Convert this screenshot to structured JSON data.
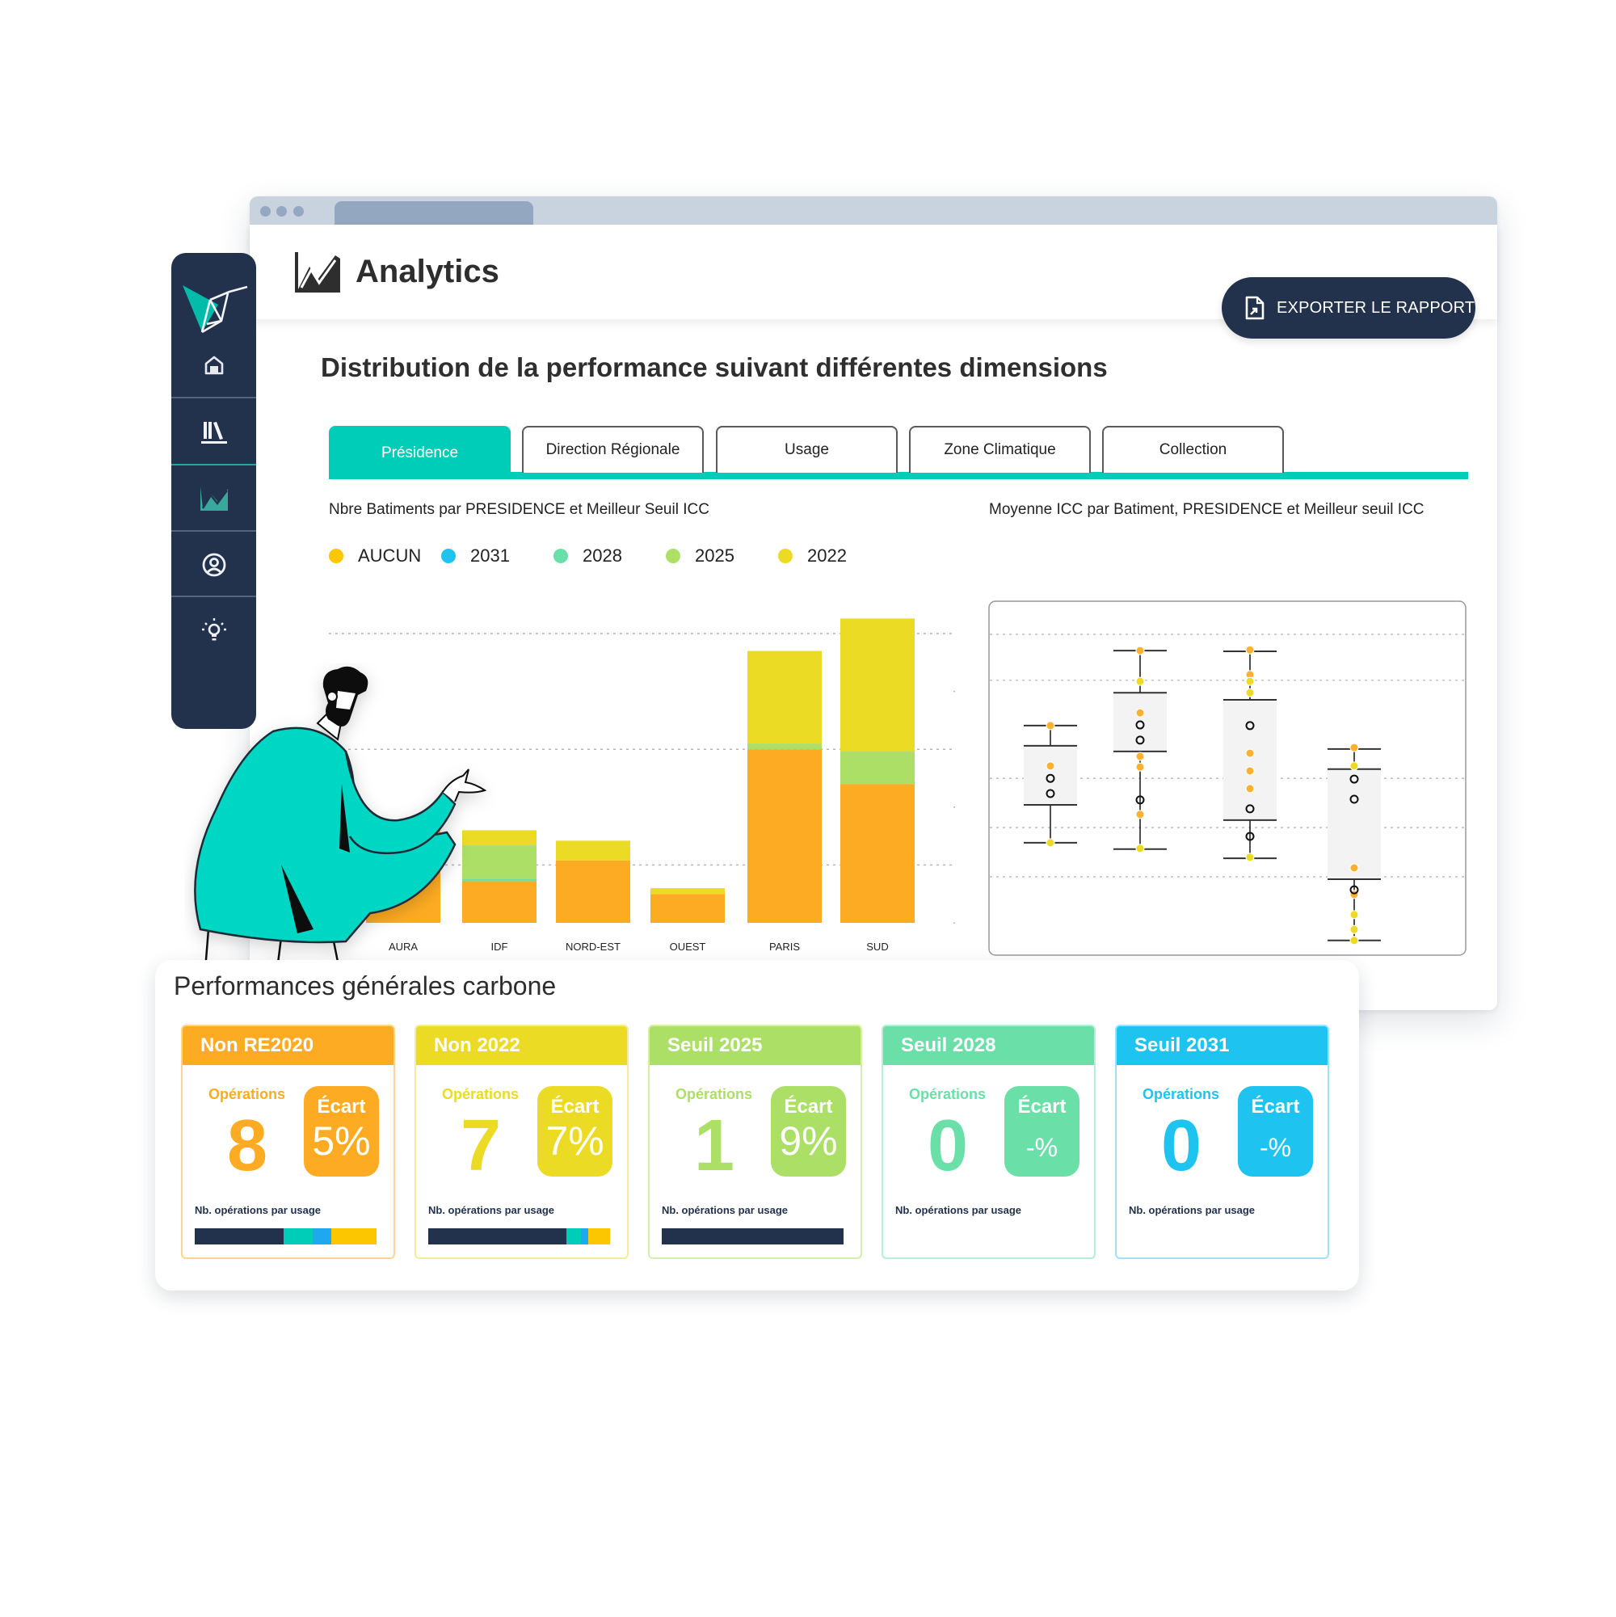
{
  "window": {
    "title": "Analytics",
    "browser_dots": 3
  },
  "header": {
    "title": "Analytics",
    "icon": "analytics-chart-icon",
    "export_label": "EXPORTER LE RAPPORT",
    "export_icon": "file-export-icon"
  },
  "sidebar": {
    "logo": "origami-bird-logo",
    "items": [
      {
        "name": "home",
        "icon": "home-icon",
        "active": false
      },
      {
        "name": "library",
        "icon": "library-icon",
        "active": false
      },
      {
        "name": "analytics",
        "icon": "analytics-chart-icon",
        "active": true
      },
      {
        "name": "profile",
        "icon": "user-circle-icon",
        "active": false
      },
      {
        "name": "ideas",
        "icon": "lightbulb-icon",
        "active": false
      }
    ]
  },
  "colors": {
    "navy": "#22324c",
    "teal": "#00cdb7",
    "aucun": "#fcc600",
    "s2031": "#1fc3ef",
    "s2028": "#6adfa8",
    "s2025": "#acdf66",
    "s2022": "#ecdb24",
    "bar_aucun": "#fdab22"
  },
  "section_title": "Distribution de la performance suivant différentes dimensions",
  "tabs": [
    {
      "label": "Présidence",
      "active": true
    },
    {
      "label": "Direction Régionale",
      "active": false
    },
    {
      "label": "Usage",
      "active": false
    },
    {
      "label": "Zone Climatique",
      "active": false
    },
    {
      "label": "Collection",
      "active": false
    }
  ],
  "chart_data": [
    {
      "type": "bar",
      "stacked": true,
      "title": "Nbre Batiments par PRESIDENCE et Meilleur Seuil ICC",
      "xlabel": "",
      "ylabel": "",
      "legend": [
        "AUCUN",
        "2031",
        "2028",
        "2025",
        "2022"
      ],
      "legend_position": "top-left",
      "grid": true,
      "ylim": [
        0,
        27
      ],
      "gridlines": [
        5,
        15,
        25
      ],
      "ticks": [
        0,
        10,
        20
      ],
      "categories": [
        "AURA",
        "IDF",
        "NORD-EST",
        "OUEST",
        "PARIS",
        "SUD"
      ],
      "series": [
        {
          "name": "AUCUN",
          "values": [
            8.0,
            3.6,
            5.4,
            2.5,
            15.0,
            12.0
          ]
        },
        {
          "name": "2031",
          "values": [
            0,
            0,
            0,
            0,
            0,
            0
          ]
        },
        {
          "name": "2028",
          "values": [
            0,
            0.2,
            0,
            0,
            0,
            0
          ]
        },
        {
          "name": "2025",
          "values": [
            0.2,
            2.9,
            0,
            0,
            0.5,
            2.8
          ]
        },
        {
          "name": "2022",
          "values": [
            0.3,
            1.3,
            1.7,
            0.5,
            8.0,
            11.5
          ]
        }
      ]
    },
    {
      "type": "box",
      "title": "Moyenne ICC par Batiment, PRESIDENCE et Meilleur seuil ICC",
      "xlabel": "",
      "ylabel": "",
      "ylim": [
        0,
        100
      ],
      "grid": true,
      "gridlines": [
        90.2,
        77.2,
        49.5,
        35.6,
        21.7
      ],
      "boxes": [
        {
          "whisker_high": 64.4,
          "q3": 58.7,
          "q1": 42.0,
          "whisker_low": 31.3,
          "points": [
            {
              "v": 64.4,
              "s": "AUCUN"
            },
            {
              "v": 53.0,
              "s": "AUCUN"
            },
            {
              "v": 49.5,
              "s": "outlier"
            },
            {
              "v": 45.2,
              "s": "outlier"
            },
            {
              "v": 31.3,
              "s": "2022"
            }
          ]
        },
        {
          "whisker_high": 85.6,
          "q3": 73.7,
          "q1": 57.1,
          "whisker_low": 29.5,
          "points": [
            {
              "v": 85.6,
              "s": "AUCUN"
            },
            {
              "v": 76.9,
              "s": "2022"
            },
            {
              "v": 68.0,
              "s": "AUCUN"
            },
            {
              "v": 64.6,
              "s": "outlier"
            },
            {
              "v": 60.3,
              "s": "outlier"
            },
            {
              "v": 55.7,
              "s": "AUCUN"
            },
            {
              "v": 52.7,
              "s": "AUCUN"
            },
            {
              "v": 43.4,
              "s": "outlier"
            },
            {
              "v": 39.3,
              "s": "AUCUN"
            },
            {
              "v": 29.7,
              "s": "2022"
            }
          ]
        },
        {
          "whisker_high": 85.4,
          "q3": 71.7,
          "q1": 37.7,
          "whisker_low": 26.9,
          "points": [
            {
              "v": 85.8,
              "s": "AUCUN"
            },
            {
              "v": 78.8,
              "s": "AUCUN"
            },
            {
              "v": 76.9,
              "s": "2022"
            },
            {
              "v": 73.7,
              "s": "2022"
            },
            {
              "v": 64.4,
              "s": "outlier"
            },
            {
              "v": 56.6,
              "s": "AUCUN"
            },
            {
              "v": 51.6,
              "s": "AUCUN"
            },
            {
              "v": 46.6,
              "s": "AUCUN"
            },
            {
              "v": 40.9,
              "s": "outlier"
            },
            {
              "v": 33.1,
              "s": "outlier"
            },
            {
              "v": 27.2,
              "s": "2022"
            }
          ]
        },
        {
          "whisker_high": 57.8,
          "q3": 52.1,
          "q1": 21.0,
          "whisker_low": 3.7,
          "points": [
            {
              "v": 58.2,
              "s": "AUCUN"
            },
            {
              "v": 53.0,
              "s": "2022"
            },
            {
              "v": 49.3,
              "s": "outlier"
            },
            {
              "v": 43.6,
              "s": "outlier"
            },
            {
              "v": 24.2,
              "s": "AUCUN"
            },
            {
              "v": 16.7,
              "s": "AUCUN"
            },
            {
              "v": 18.0,
              "s": "outlier"
            },
            {
              "v": 11.0,
              "s": "2022"
            },
            {
              "v": 6.8,
              "s": "2022"
            },
            {
              "v": 3.7,
              "s": "2022"
            }
          ]
        }
      ]
    }
  ],
  "person_illustration": "man-in-teal-coat-pointing",
  "performance": {
    "title": "Performances générales carbone",
    "cards": [
      {
        "title": "Non RE2020",
        "color": "#fdab22",
        "border": "#fdd590",
        "ops_label": "Opérations",
        "ops_value": "8",
        "ecart_label": "Écart",
        "ecart_value": "5%",
        "usage_label": "Nb. opérations par usage",
        "usage": [
          {
            "pct": 49,
            "color": "#22324c"
          },
          {
            "pct": 16,
            "color": "#00cdb7"
          },
          {
            "pct": 10,
            "color": "#1fa7ef"
          },
          {
            "pct": 25,
            "color": "#fcc600"
          }
        ]
      },
      {
        "title": "Non 2022",
        "color": "#ecdb24",
        "border": "#f5ec96",
        "ops_label": "Opérations",
        "ops_value": "7",
        "ecart_label": "Écart",
        "ecart_value": "7%",
        "usage_label": "Nb. opérations par usage",
        "usage": [
          {
            "pct": 76,
            "color": "#22324c"
          },
          {
            "pct": 8,
            "color": "#00cdb7"
          },
          {
            "pct": 4,
            "color": "#1fa7ef"
          },
          {
            "pct": 12,
            "color": "#fcc600"
          }
        ]
      },
      {
        "title": "Seuil 2025",
        "color": "#acdf66",
        "border": "#d3efae",
        "ops_label": "Opérations",
        "ops_value": "1",
        "ecart_label": "Écart",
        "ecart_value": "9%",
        "usage_label": "Nb. opérations par usage",
        "usage": [
          {
            "pct": 100,
            "color": "#22324c"
          }
        ]
      },
      {
        "title": "Seuil 2028",
        "color": "#6adfa8",
        "border": "#b5efd3",
        "ops_label": "Opérations",
        "ops_value": "0",
        "ecart_label": "Écart",
        "ecart_value": "-%",
        "usage_label": "Nb. opérations par usage",
        "usage": []
      },
      {
        "title": "Seuil 2031",
        "color": "#1fc3ef",
        "border": "#9fe1f7",
        "ops_label": "Opérations",
        "ops_value": "0",
        "ecart_label": "Écart",
        "ecart_value": "-%",
        "usage_label": "Nb. opérations par usage",
        "usage": []
      }
    ]
  }
}
